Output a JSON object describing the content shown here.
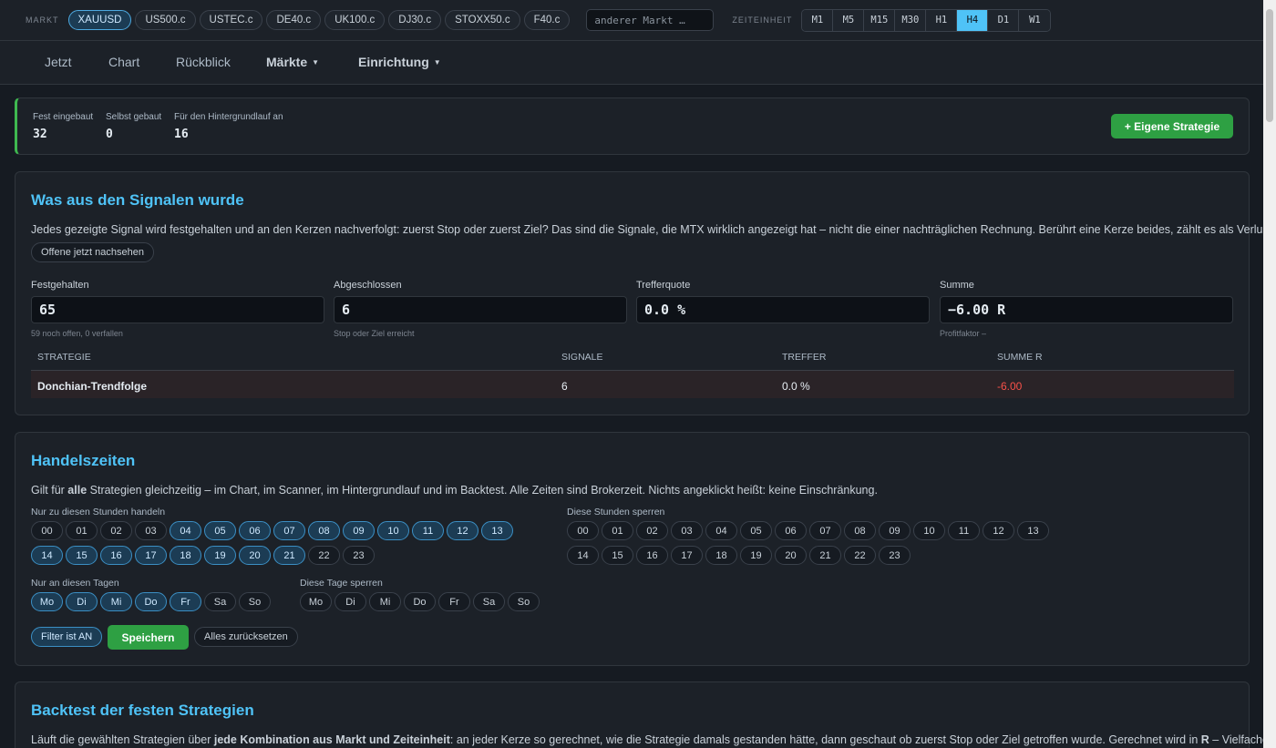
{
  "topbar": {
    "market_label": "MARKT",
    "markets": [
      "XAUUSD",
      "US500.c",
      "USTEC.c",
      "DE40.c",
      "UK100.c",
      "DJ30.c",
      "STOXX50.c",
      "F40.c"
    ],
    "active_market": "XAUUSD",
    "search_placeholder": "anderer Markt …",
    "timeframe_label": "ZEITEINHEIT",
    "timeframes": [
      "M1",
      "M5",
      "M15",
      "M30",
      "H1",
      "H4",
      "D1",
      "W1"
    ],
    "active_timeframe": "H4"
  },
  "nav": {
    "items": [
      "Jetzt",
      "Chart",
      "Rückblick",
      "Märkte",
      "Einrichtung"
    ],
    "caret": "▼"
  },
  "statbar": {
    "stats": [
      {
        "label": "Fest eingebaut",
        "value": "32"
      },
      {
        "label": "Selbst gebaut",
        "value": "0"
      },
      {
        "label": "Für den Hintergrundlauf an",
        "value": "16"
      }
    ],
    "add_button": "+ Eigene Strategie"
  },
  "signals": {
    "title": "Was aus den Signalen wurde",
    "description": "Jedes gezeigte Signal wird festgehalten und an den Kerzen nachverfolgt: zuerst Stop oder zuerst Ziel? Das sind die Signale, die MTX wirklich angezeigt hat – nicht die einer nachträglichen Rechnung. Berührt eine Kerze beides, zählt es als Verlust.",
    "check_button": "Offene jetzt nachsehen",
    "fields": [
      {
        "label": "Festgehalten",
        "value": "65",
        "sub": "59 noch offen, 0 verfallen"
      },
      {
        "label": "Abgeschlossen",
        "value": "6",
        "sub": "Stop oder Ziel erreicht"
      },
      {
        "label": "Trefferquote",
        "value": "0.0 %",
        "sub": ""
      },
      {
        "label": "Summe",
        "value": "−6.00 R",
        "sub": "Profitfaktor –"
      }
    ],
    "table": {
      "headers": [
        "STRATEGIE",
        "SIGNALE",
        "TREFFER",
        "SUMME R"
      ],
      "rows": [
        {
          "strategy": "Donchian-Trendfolge",
          "signals": "6",
          "hits": "0.0 %",
          "sum_r": "-6.00"
        }
      ]
    }
  },
  "hours": {
    "title": "Handelszeiten",
    "desc_pre": "Gilt für ",
    "desc_bold": "alle",
    "desc_post": " Strategien gleichzeitig – im Chart, im Scanner, im Hintergrundlauf und im Backtest. Alle Zeiten sind Brokerzeit. Nichts angeklickt heißt: keine Einschränkung.",
    "trade_hours_label": "Nur zu diesen Stunden handeln",
    "block_hours_label": "Diese Stunden sperren",
    "hours": [
      "00",
      "01",
      "02",
      "03",
      "04",
      "05",
      "06",
      "07",
      "08",
      "09",
      "10",
      "11",
      "12",
      "13",
      "14",
      "15",
      "16",
      "17",
      "18",
      "19",
      "20",
      "21",
      "22",
      "23"
    ],
    "trade_hours_selected": [
      "04",
      "05",
      "06",
      "07",
      "08",
      "09",
      "10",
      "11",
      "12",
      "13",
      "14",
      "15",
      "16",
      "17",
      "18",
      "19",
      "20",
      "21"
    ],
    "trade_days_label": "Nur an diesen Tagen",
    "block_days_label": "Diese Tage sperren",
    "days": [
      "Mo",
      "Di",
      "Mi",
      "Do",
      "Fr",
      "Sa",
      "So"
    ],
    "trade_days_selected": [
      "Mo",
      "Di",
      "Mi",
      "Do",
      "Fr"
    ],
    "filter_button": "Filter ist AN",
    "save_button": "Speichern",
    "reset_button": "Alles zurücksetzen"
  },
  "backtest": {
    "title": "Backtest der festen Strategien",
    "desc_pre": "Läuft die gewählten Strategien über ",
    "desc_bold": "jede Kombination aus Markt und Zeiteinheit",
    "desc_mid": ": an jeder Kerze so gerechnet, wie die Strategie damals gestanden hätte, dann geschaut ob zuerst Stop oder Ziel getroffen wurde. Gerechnet wird in ",
    "desc_bold2": "R",
    "desc_post": " – Vielfachen des"
  },
  "colors": {
    "accent": "#4fc3f7",
    "green": "#2ea043",
    "red": "#f85149",
    "background": "#161b22",
    "card": "#1c2128"
  }
}
